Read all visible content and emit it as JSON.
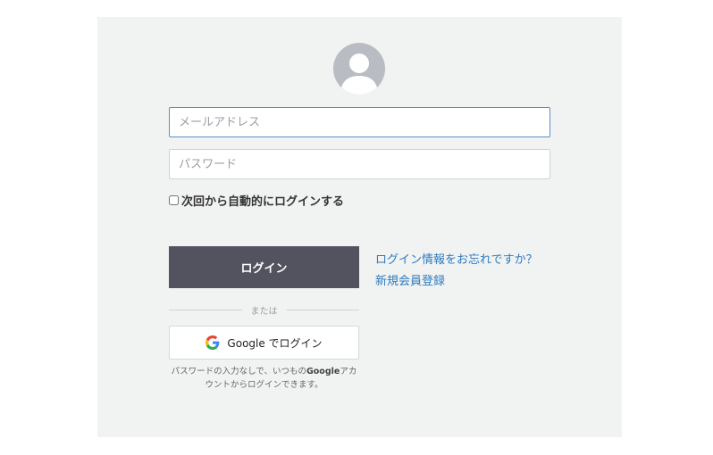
{
  "form": {
    "email_placeholder": "メールアドレス",
    "password_placeholder": "パスワード",
    "remember_label": "次回から自動的にログインする",
    "login_button": "ログイン",
    "forgot_link": "ログイン情報をお忘れですか？",
    "register_link": "新規会員登録"
  },
  "divider_text": "または",
  "google": {
    "button_label": "Google でログイン",
    "note_prefix": "パスワードの入力なしで、いつもの",
    "note_brand": "Google",
    "note_suffix": "アカウントからログインできます。"
  },
  "icons": {
    "avatar": "user-avatar-icon",
    "google": "google-g-icon"
  },
  "colors": {
    "panel_bg": "#f1f2f2",
    "login_button_bg": "#53525f",
    "link": "#2b7bbf",
    "focus_border": "#5a8dc8"
  }
}
